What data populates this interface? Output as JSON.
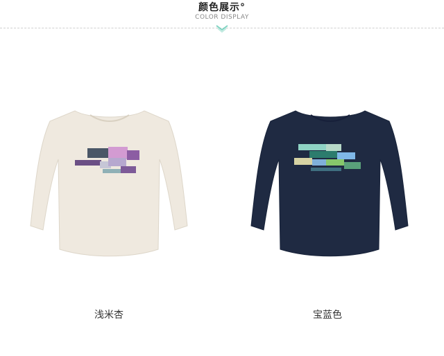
{
  "header": {
    "title": "颜色展示°",
    "subtitle": "COLOR DISPLAY"
  },
  "products": [
    {
      "label": "浅米杏",
      "color": "#efe9df"
    },
    {
      "label": "宝蓝色",
      "color": "#1f2a42"
    }
  ]
}
